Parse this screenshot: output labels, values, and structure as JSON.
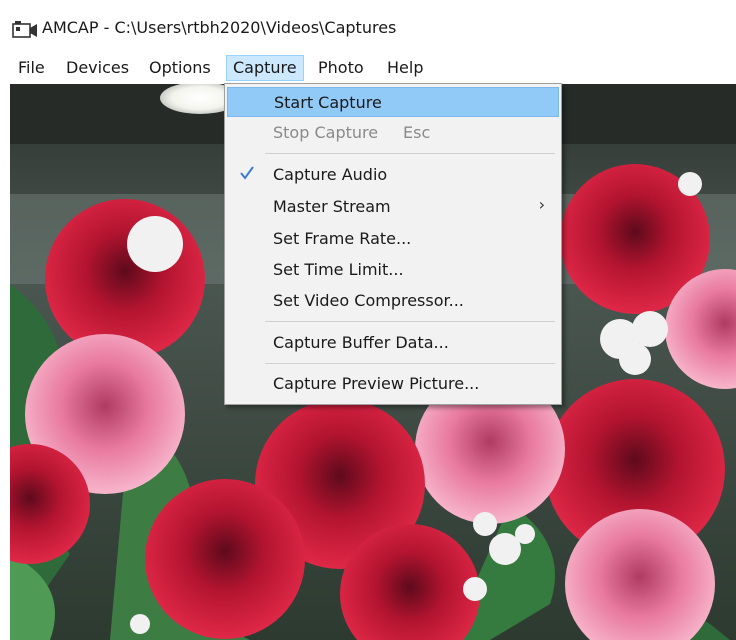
{
  "window": {
    "title": "AMCAP - C:\\Users\\rtbh2020\\Videos\\Captures",
    "icon": "camera-icon"
  },
  "menubar": {
    "items": [
      {
        "label": "File"
      },
      {
        "label": "Devices"
      },
      {
        "label": "Options"
      },
      {
        "label": "Capture"
      },
      {
        "label": "Photo"
      },
      {
        "label": "Help"
      }
    ],
    "open_menu": "Capture"
  },
  "capture_menu": {
    "items": [
      {
        "label": "Start Capture",
        "highlighted": true
      },
      {
        "label": "Stop Capture",
        "shortcut": "Esc",
        "disabled": true
      },
      {
        "label": "Capture Audio",
        "checked": true
      },
      {
        "label": "Master Stream",
        "submenu": true,
        "arrow": "›"
      },
      {
        "label": "Set Frame Rate..."
      },
      {
        "label": "Set Time Limit..."
      },
      {
        "label": "Set Video Compressor..."
      },
      {
        "label": "Capture Buffer Data..."
      },
      {
        "label": "Capture Preview Picture..."
      }
    ]
  },
  "colors": {
    "menu_highlight": "#91c9f7",
    "menubar_open": "#cce8ff",
    "menu_background": "#f2f2f2",
    "disabled_text": "#8a8a8a",
    "check_mark": "#3a7bd5"
  }
}
